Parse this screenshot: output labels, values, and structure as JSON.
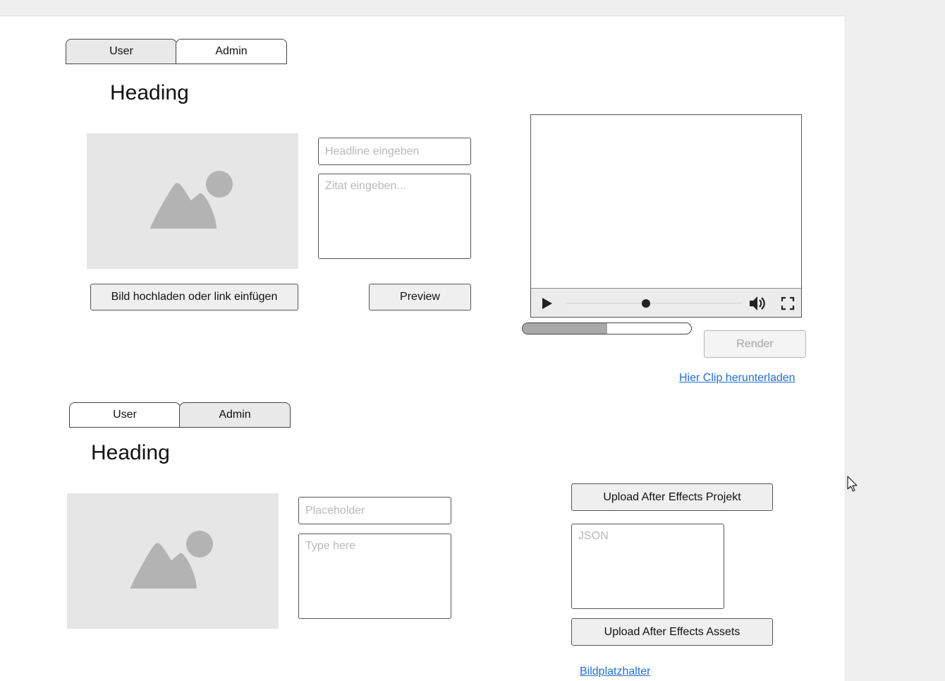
{
  "section1": {
    "tabs": [
      {
        "label": "User",
        "active": true
      },
      {
        "label": "Admin",
        "active": false
      }
    ],
    "heading": "Heading",
    "headline_placeholder": "Headline eingeben",
    "quote_placeholder": "Zitat eingeben...",
    "upload_button": "Bild hochladen oder link einfügen",
    "preview_button": "Preview",
    "video": {
      "seek_fraction": 0.46
    },
    "progress": {
      "fraction": 0.5
    },
    "render_button": "Render",
    "download_link": "Hier Clip herunterladen"
  },
  "section2": {
    "tabs": [
      {
        "label": "User",
        "active": false
      },
      {
        "label": "Admin",
        "active": true
      }
    ],
    "heading": "Heading",
    "input_placeholder": "Placeholder",
    "textarea_placeholder": "Type here",
    "upload_project_button": "Upload After Effects Projekt",
    "json_placeholder": "JSON",
    "upload_assets_button": "Upload After Effects Assets",
    "image_placeholder_link": "Bildplatzhalter"
  },
  "icons": {
    "image": "image-placeholder-icon",
    "play": "play-icon",
    "volume": "volume-icon",
    "fullscreen": "fullscreen-icon",
    "cursor": "mouse-cursor-icon"
  },
  "colors": {
    "link": "#1f6fd4",
    "placeholder_bg": "#e6e6e6",
    "page_bg": "#efefef"
  }
}
